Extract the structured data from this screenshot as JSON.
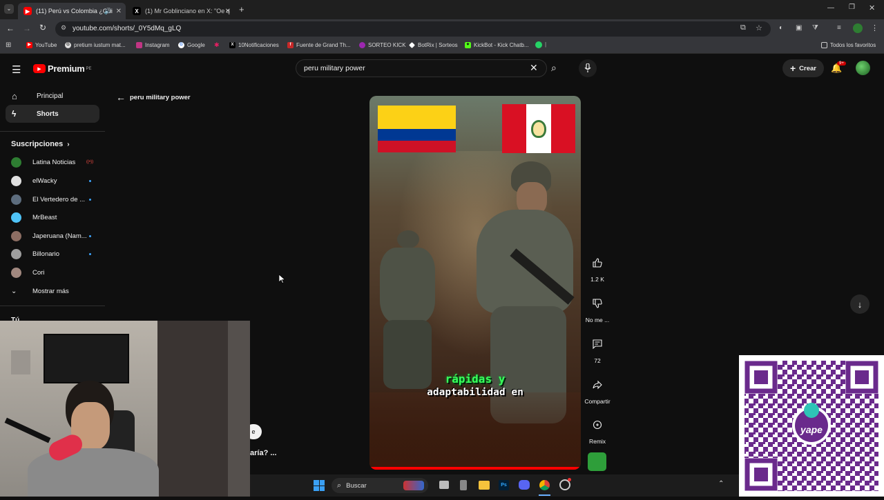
{
  "browser": {
    "tabs": [
      {
        "title": "(11) Perú vs Colombia ¿Qui",
        "active": true
      },
      {
        "title": "(1) Mr Goblinciano en X: \"Oe q",
        "active": false
      }
    ],
    "new_tab": "+",
    "url": "youtube.com/shorts/_0Y5dMq_gLQ",
    "bookmarks": [
      "YouTube",
      "pretium iustum mat...",
      "Instagram",
      "Google",
      "10Notificaciones",
      "Fuente de Grand Th...",
      "SORTEO KICK",
      "BotRix | Sorteos",
      "KickBot - Kick Chatb..."
    ],
    "all_bookmarks": "Todos los favoritos"
  },
  "youtube": {
    "logo": "Premium",
    "region": "PE",
    "search_query": "peru military power",
    "create_label": "Crear",
    "notif_badge": "9+",
    "back_label": "peru military power",
    "nav": [
      {
        "label": "Principal",
        "icon": "home-icon"
      },
      {
        "label": "Shorts",
        "icon": "shorts-icon"
      }
    ],
    "subscriptions_header": "Suscripciones",
    "subscriptions": [
      {
        "name": "Latina Noticias",
        "live": true,
        "color": "#2e7d32"
      },
      {
        "name": "elWacky",
        "dot": true,
        "color": "#e0e0e0"
      },
      {
        "name": "El Vertedero de ...",
        "dot": true,
        "color": "#5d6d7e"
      },
      {
        "name": "MrBeast",
        "dot": false,
        "color": "#4fc3f7"
      },
      {
        "name": "Japeruana (Nam...",
        "dot": true,
        "color": "#8d6e63"
      },
      {
        "name": "Billonario",
        "dot": true,
        "color": "#9e9e9e"
      },
      {
        "name": "Cori",
        "dot": false,
        "color": "#a1887f"
      }
    ],
    "show_more": "Mostrar más",
    "you_partial": "Tú",
    "caption_line1": "rápidas y",
    "caption_line2": "adaptabilidad en",
    "partial_text": "aría?  ...",
    "partial_button": "e",
    "actions": {
      "likes": "1.2 K",
      "dislike": "No me ...",
      "comments": "72",
      "share": "Compartir",
      "remix": "Remix"
    }
  },
  "overlay": {
    "qr_label": "yape"
  },
  "taskbar": {
    "search": "Buscar"
  }
}
